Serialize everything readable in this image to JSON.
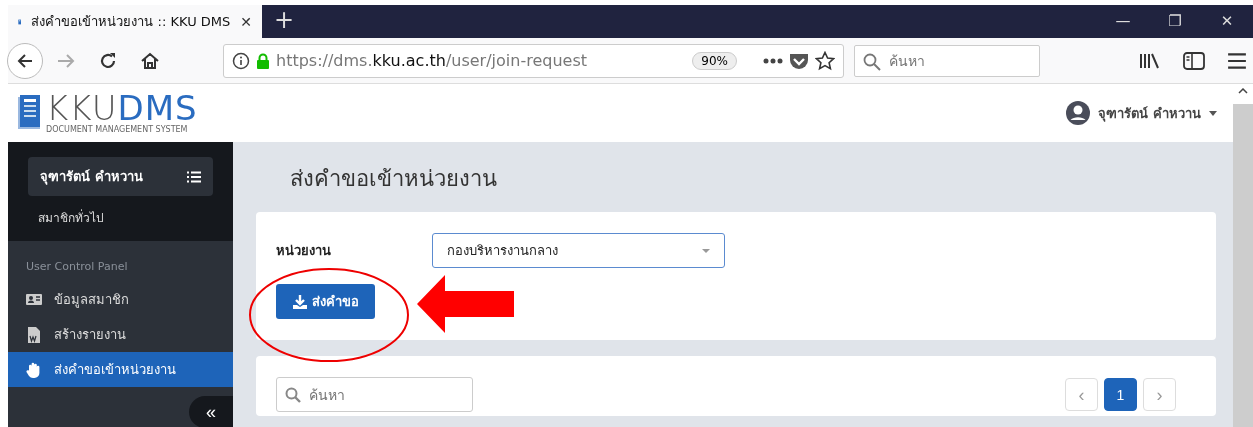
{
  "browser": {
    "tabs": [
      {
        "title": "ส่งคำขอเข้าหน่วยงาน :: KKU DMS",
        "selected": true,
        "close": "✕"
      }
    ],
    "new_tab": "+",
    "window_controls": [
      "—",
      "❐",
      "✕"
    ],
    "url": {
      "prefix": "https://dms.",
      "domain": "kku.ac.th",
      "path": "/user/join-request"
    },
    "zoom": "90%",
    "search": {
      "placeholder": "ค้นหา"
    }
  },
  "header": {
    "logo": {
      "part_1": "KKU",
      "part_2": "DMS",
      "subtitle": "DOCUMENT MANAGEMENT SYSTEM"
    },
    "user": {
      "name": "จุฑารัตน์ คำหวาน"
    }
  },
  "sidebar": {
    "user_name": "จุฑารัตน์ คำหวาน",
    "role": "สมาชิกทั่วไป",
    "section": "User Control Panel",
    "items": [
      {
        "label": "ข้อมูลสมาชิก",
        "kind": "card",
        "selected": false
      },
      {
        "label": "สร้างรายงาน",
        "kind": "doc",
        "selected": false
      },
      {
        "label": "ส่งคำขอเข้าหน่วยงาน",
        "kind": "hand",
        "selected": true
      }
    ],
    "collapse": "«"
  },
  "page": {
    "title": "ส่งคำขอเข้าหน่วยงาน",
    "form": {
      "label": "หน่วยงาน",
      "value": "กองบริหารงานกลาง",
      "submit": "ส่งคำขอ"
    },
    "list": {
      "search": {
        "placeholder": "ค้นหา"
      },
      "pagination": [
        {
          "label": "‹",
          "kind": "prev",
          "selected": false
        },
        {
          "label": "1",
          "kind": "page",
          "selected": true
        },
        {
          "label": "›",
          "kind": "next",
          "selected": false
        }
      ]
    }
  }
}
